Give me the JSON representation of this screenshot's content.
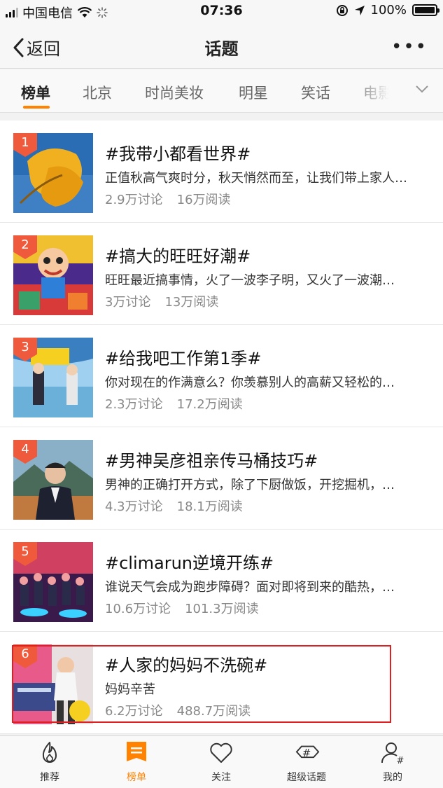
{
  "status_bar": {
    "carrier": "中国电信",
    "time": "07:36",
    "battery": "100%"
  },
  "nav": {
    "back_label": "返回",
    "title": "话题"
  },
  "tabs": [
    {
      "label": "榜单",
      "active": true
    },
    {
      "label": "北京",
      "active": false
    },
    {
      "label": "时尚美妆",
      "active": false
    },
    {
      "label": "明星",
      "active": false
    },
    {
      "label": "笑话",
      "active": false
    },
    {
      "label": "电影",
      "active": false
    }
  ],
  "topics": [
    {
      "rank": "1",
      "title": "#我带小都看世界#",
      "desc": "正值秋高气爽时分，秋天悄然而至，让我们带上家人…",
      "discuss": "2.9万讨论",
      "read": "16万阅读"
    },
    {
      "rank": "2",
      "title": "#搞大的旺旺好潮#",
      "desc": "旺旺最近搞事情，火了一波李子明，又火了一波潮…",
      "discuss": "3万讨论",
      "read": "13万阅读"
    },
    {
      "rank": "3",
      "title": "#给我吧工作第1季#",
      "desc": "你对现在的作满意么？你羡慕别人的高薪又轻松的…",
      "discuss": "2.3万讨论",
      "read": "17.2万阅读"
    },
    {
      "rank": "4",
      "title": "#男神吴彦祖亲传马桶技巧#",
      "desc": "男神的正确打开方式，除了下厨做饭，开挖掘机，…",
      "discuss": "4.3万讨论",
      "read": "18.1万阅读"
    },
    {
      "rank": "5",
      "title": "#climarun逆境开练#",
      "desc": "谁说天气会成为跑步障碍？面对即将到来的酷热，…",
      "discuss": "10.6万讨论",
      "read": "101.3万阅读"
    },
    {
      "rank": "6",
      "title": "#人家的妈妈不洗碗#",
      "desc": "妈妈辛苦",
      "discuss": "6.2万讨论",
      "read": "488.7万阅读"
    }
  ],
  "tabbar": [
    {
      "label": "推荐",
      "icon": "flame-icon",
      "active": false
    },
    {
      "label": "榜单",
      "icon": "ranking-icon",
      "active": true
    },
    {
      "label": "关注",
      "icon": "heart-icon",
      "active": false
    },
    {
      "label": "超级话题",
      "icon": "super-topic-icon",
      "active": false
    },
    {
      "label": "我的",
      "icon": "profile-icon",
      "active": false
    }
  ],
  "colors": {
    "accent": "#ff8200",
    "rank_badge": "#f05a3c",
    "highlight_box": "#e02020"
  }
}
